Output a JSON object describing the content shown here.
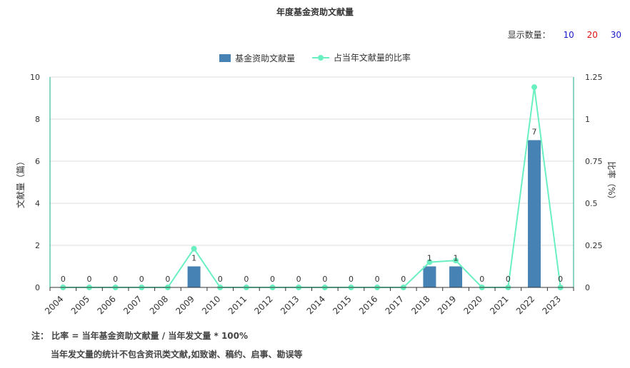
{
  "chart_data": {
    "type": "bar",
    "title": "年度基金资助文献量",
    "categories": [
      "2004",
      "2005",
      "2006",
      "2007",
      "2008",
      "2009",
      "2010",
      "2011",
      "2012",
      "2013",
      "2014",
      "2015",
      "2016",
      "2017",
      "2018",
      "2019",
      "2020",
      "2021",
      "2022",
      "2023"
    ],
    "series": [
      {
        "name": "基金资助文献量",
        "type": "bar",
        "axis": "left",
        "color": "#4682b4",
        "values": [
          0,
          0,
          0,
          0,
          0,
          1,
          0,
          0,
          0,
          0,
          0,
          0,
          0,
          0,
          1,
          1,
          0,
          0,
          7,
          0
        ]
      },
      {
        "name": "占当年文献量的比率",
        "type": "line",
        "axis": "right",
        "color": "#6af0c0",
        "values": [
          0,
          0,
          0,
          0,
          0,
          0.23,
          0,
          0,
          0,
          0,
          0,
          0,
          0,
          0,
          0.15,
          0.16,
          0,
          0,
          1.19,
          0
        ]
      }
    ],
    "ylabel_left": "文献量（篇）",
    "ylabel_right": "比率（%）",
    "ylim_left": [
      0,
      10
    ],
    "yticks_left": [
      "0",
      "2",
      "4",
      "6",
      "8",
      "10"
    ],
    "ylim_right": [
      0,
      1.25
    ],
    "yticks_right": [
      "0",
      "0.25",
      "0.5",
      "0.75",
      "1",
      "1.25"
    ],
    "grid": true,
    "legend_position": "top-center"
  },
  "display_count": {
    "label": "显示数量：",
    "options": [
      {
        "label": "10",
        "color": "#1a1acc"
      },
      {
        "label": "20",
        "color": "#dd1111"
      },
      {
        "label": "30",
        "color": "#1a1acc"
      }
    ]
  },
  "notes": {
    "line1": "注： 比率 = 当年基金资助文献量 / 当年发文量 * 100%",
    "line2": "当年发文量的统计不包含资讯类文献,如致谢、稿约、启事、勘误等"
  }
}
